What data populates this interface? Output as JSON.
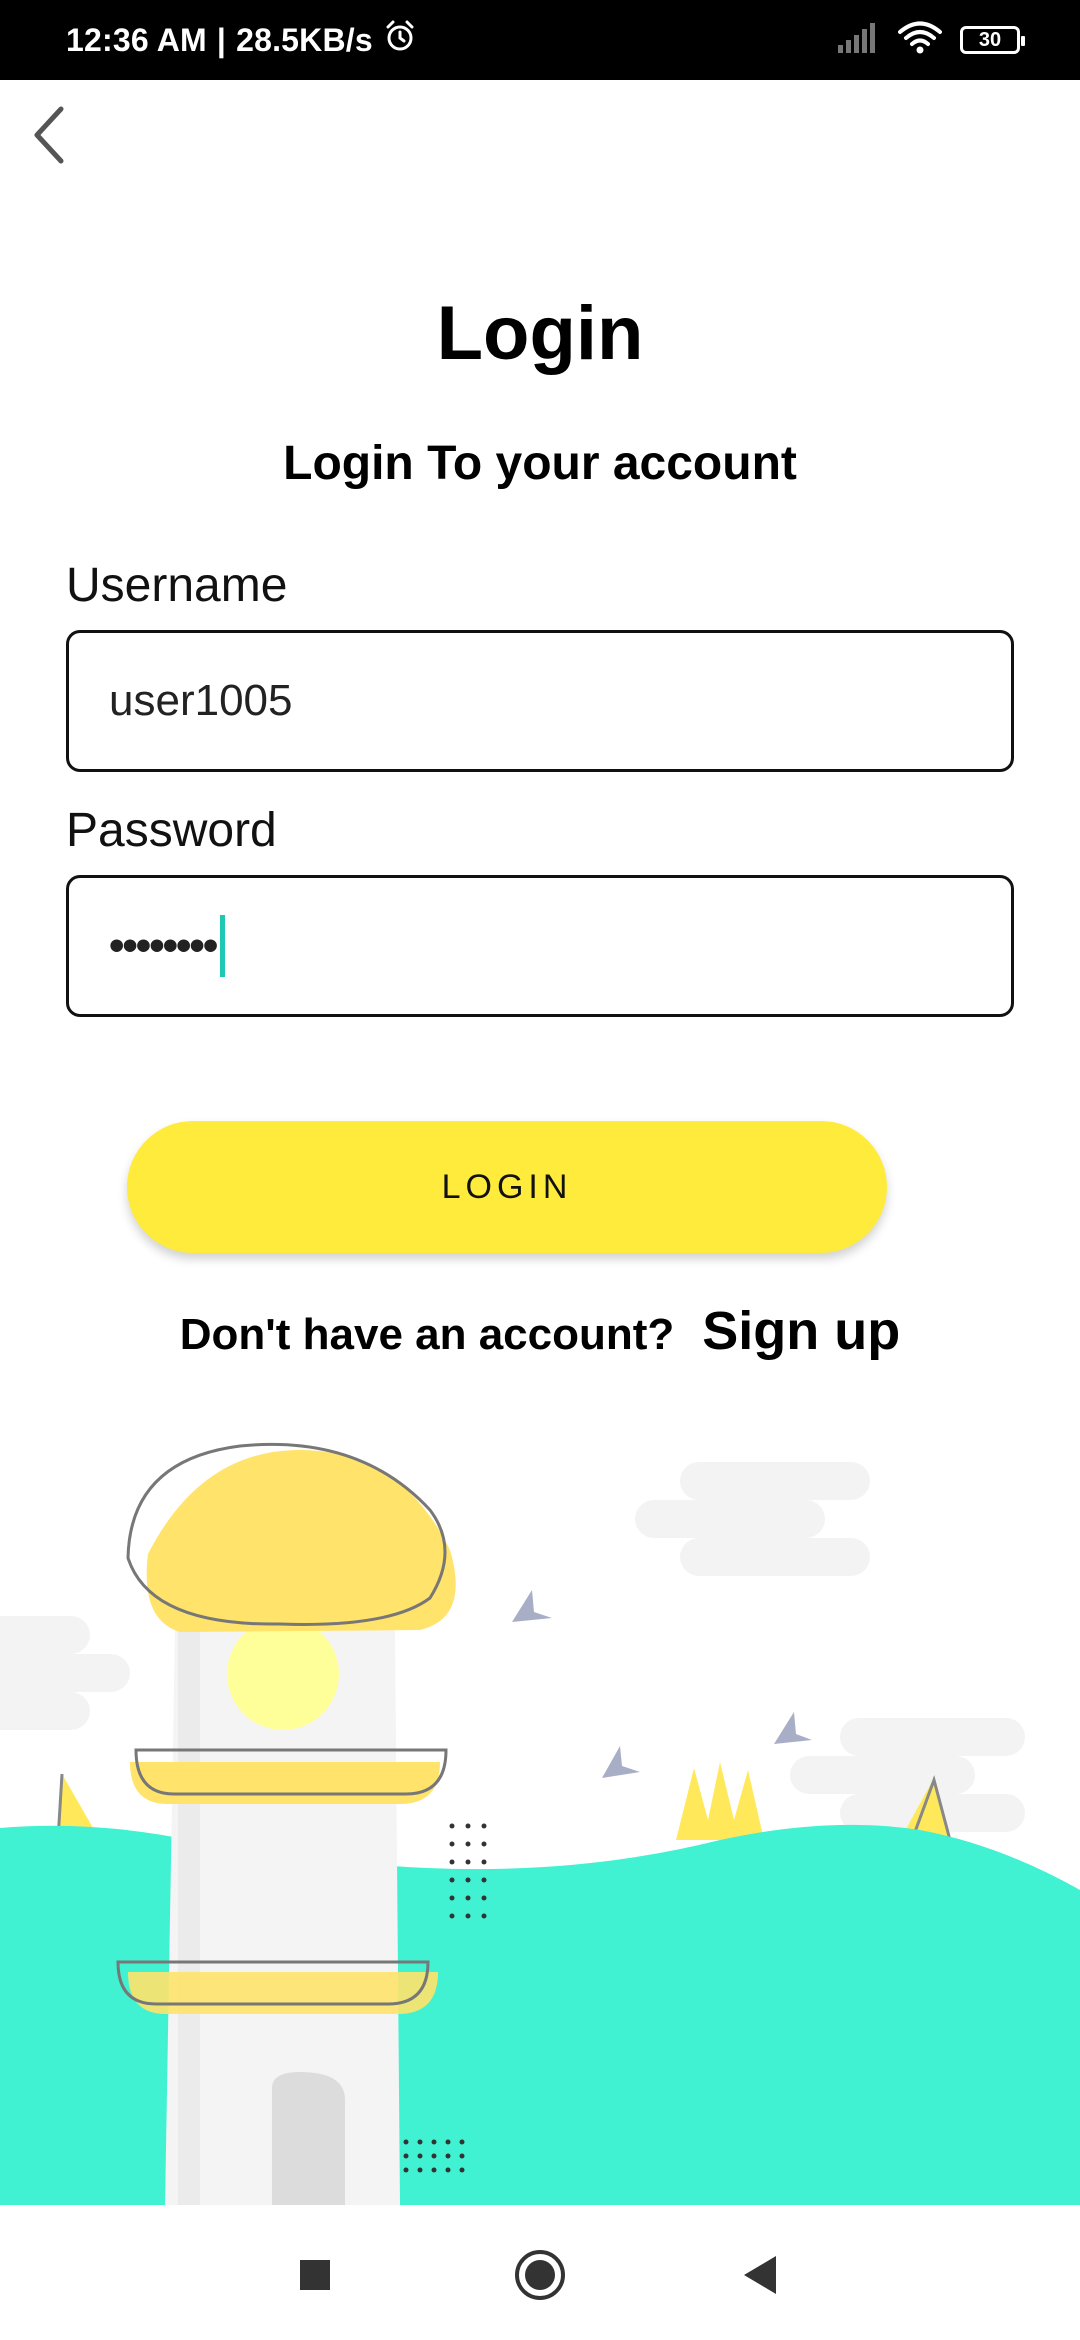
{
  "status_bar": {
    "time": "12:36 AM",
    "separator": "|",
    "net_speed": "28.5KB/s",
    "battery_level": "30"
  },
  "header": {
    "title": "Login",
    "subtitle": "Login To your account"
  },
  "form": {
    "username_label": "Username",
    "username_value": "user1005",
    "password_label": "Password",
    "password_masked": "••••••••"
  },
  "actions": {
    "login_label": "LOGIN",
    "signup_prompt": "Don't have an account?",
    "signup_link": "Sign up"
  },
  "colors": {
    "accent_yellow": "#ffeb3b",
    "hill_teal": "#40f2d2",
    "cursor_teal": "#1ec8b5"
  },
  "icons": {
    "back": "chevron-left-icon",
    "alarm": "alarm-icon",
    "signal": "signal-icon",
    "wifi": "wifi-icon",
    "battery": "battery-icon",
    "nav_recents": "square-icon",
    "nav_home": "circle-icon",
    "nav_back": "triangle-back-icon"
  }
}
